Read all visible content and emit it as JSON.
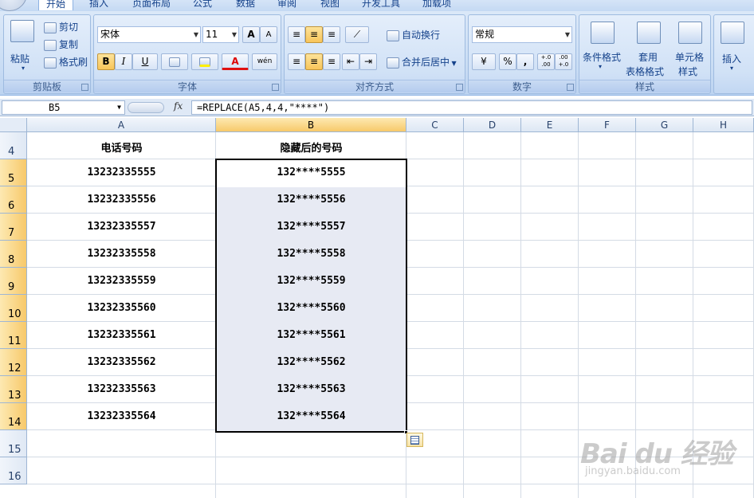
{
  "ribbon": {
    "tabs": [
      "开始",
      "插入",
      "页面布局",
      "公式",
      "数据",
      "审阅",
      "视图",
      "开发工具",
      "加载项"
    ],
    "active_tab": "开始",
    "clipboard": {
      "label": "剪贴板",
      "paste": "粘贴",
      "cut": "剪切",
      "copy": "复制",
      "format_painter": "格式刷"
    },
    "font": {
      "label": "字体",
      "font_name": "宋体",
      "font_size": "11",
      "bold": "B",
      "italic": "I",
      "underline": "U",
      "font_color_glyph": "A",
      "grow": "A",
      "shrink": "A",
      "phonetic": "wén"
    },
    "alignment": {
      "label": "对齐方式",
      "wrap_text": "自动换行",
      "merge_center": "合并后居中"
    },
    "number": {
      "label": "数字",
      "format": "常规",
      "percent": "%",
      "comma": ",",
      "inc_decimal": "+.0 .00",
      "dec_decimal": ".00 +.0"
    },
    "styles": {
      "label": "样式",
      "conditional": "条件格式",
      "table_format_1": "套用",
      "table_format_2": "表格格式",
      "cell_styles_1": "单元格",
      "cell_styles_2": "样式"
    },
    "cells": {
      "insert": "插入"
    }
  },
  "formula_bar": {
    "name_box": "B5",
    "fx": "fx",
    "formula": "=REPLACE(A5,4,4,\"****\")"
  },
  "sheet": {
    "columns": [
      "A",
      "B",
      "C",
      "D",
      "E",
      "F",
      "G",
      "H"
    ],
    "selected_column": "B",
    "rows": [
      {
        "num": "4",
        "a": "电话号码",
        "b": "隐藏后的号码"
      },
      {
        "num": "5",
        "a": "13232335555",
        "b": "132****5555"
      },
      {
        "num": "6",
        "a": "13232335556",
        "b": "132****5556"
      },
      {
        "num": "7",
        "a": "13232335557",
        "b": "132****5557"
      },
      {
        "num": "8",
        "a": "13232335558",
        "b": "132****5558"
      },
      {
        "num": "9",
        "a": "13232335559",
        "b": "132****5559"
      },
      {
        "num": "10",
        "a": "13232335560",
        "b": "132****5560"
      },
      {
        "num": "11",
        "a": "13232335561",
        "b": "132****5561"
      },
      {
        "num": "12",
        "a": "13232335562",
        "b": "132****5562"
      },
      {
        "num": "13",
        "a": "13232335563",
        "b": "132****5563"
      },
      {
        "num": "14",
        "a": "13232335564",
        "b": "132****5564"
      },
      {
        "num": "15",
        "a": "",
        "b": ""
      },
      {
        "num": "16",
        "a": "",
        "b": ""
      }
    ],
    "selected_rows": [
      "5",
      "6",
      "7",
      "8",
      "9",
      "10",
      "11",
      "12",
      "13",
      "14"
    ]
  },
  "watermark": {
    "brand": "Bai du 经验",
    "url": "jingyan.baidu.com"
  }
}
